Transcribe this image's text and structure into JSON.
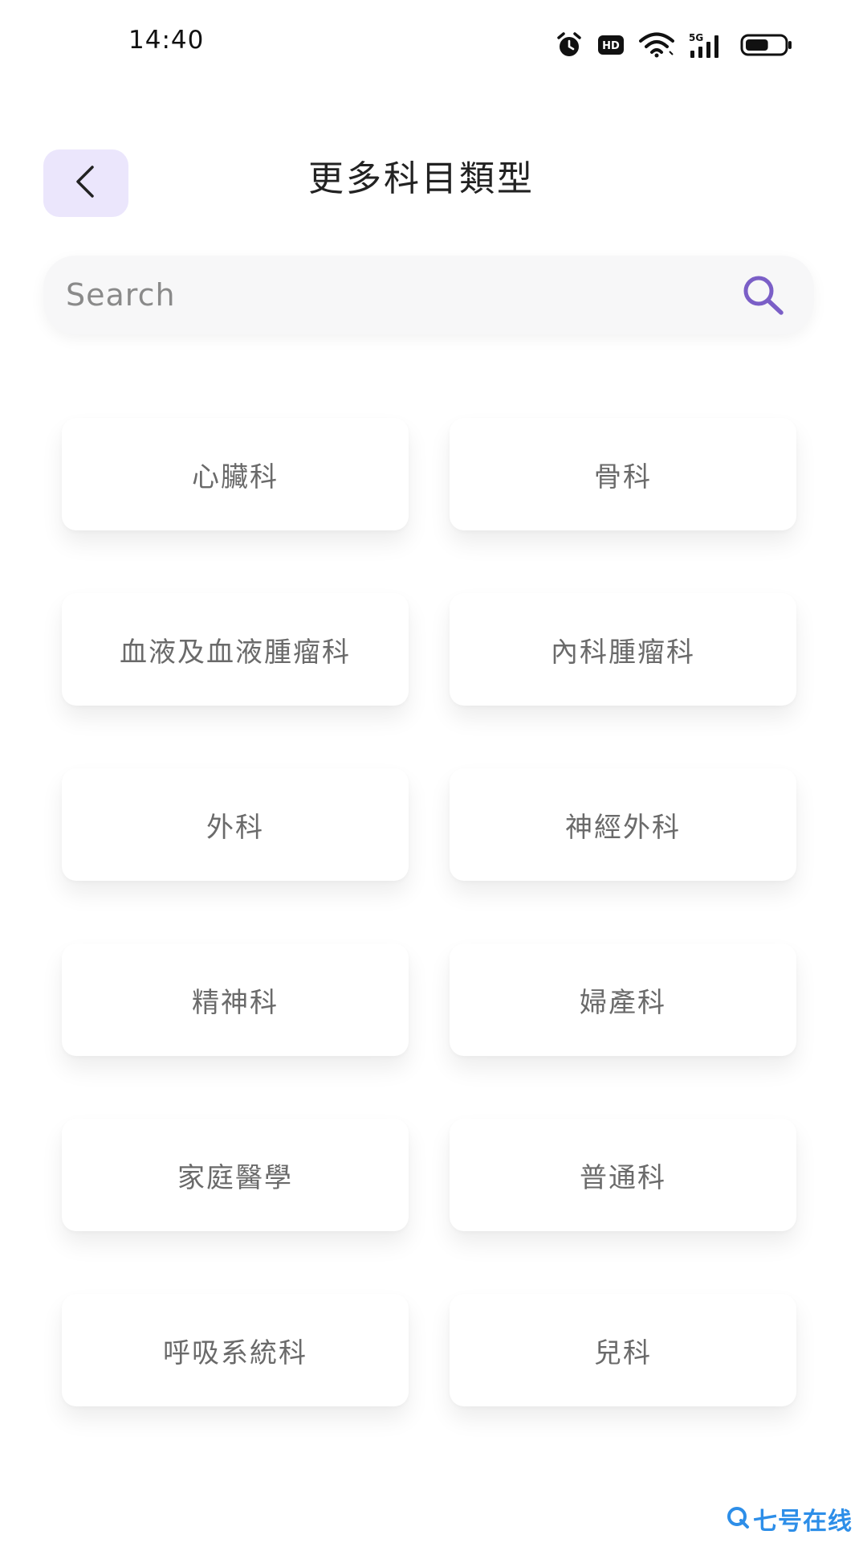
{
  "status_bar": {
    "time": "14:40",
    "icons": [
      "alarm-icon",
      "hd-icon",
      "wifi-icon",
      "signal-5g-icon",
      "battery-icon"
    ],
    "hd_label": "HD",
    "network_label": "5G",
    "battery_level": 0.6
  },
  "header": {
    "back_icon": "chevron-left-icon",
    "title": "更多科目類型"
  },
  "search": {
    "placeholder": "Search",
    "value": "",
    "icon": "search-icon"
  },
  "departments": [
    {
      "label": "心臟科"
    },
    {
      "label": "骨科"
    },
    {
      "label": "血液及血液腫瘤科"
    },
    {
      "label": "內科腫瘤科"
    },
    {
      "label": "外科"
    },
    {
      "label": "神經外科"
    },
    {
      "label": "精神科"
    },
    {
      "label": "婦產科"
    },
    {
      "label": "家庭醫學"
    },
    {
      "label": "普通科"
    },
    {
      "label": "呼吸系統科"
    },
    {
      "label": "兒科"
    }
  ],
  "watermark": {
    "text": "七号在线"
  },
  "colors": {
    "accent": "#7b5fc7",
    "back_button_bg": "#ebe6fc",
    "search_bg": "#f7f7f8",
    "card_text": "#6a6a6a",
    "watermark": "#2d8ee8"
  }
}
